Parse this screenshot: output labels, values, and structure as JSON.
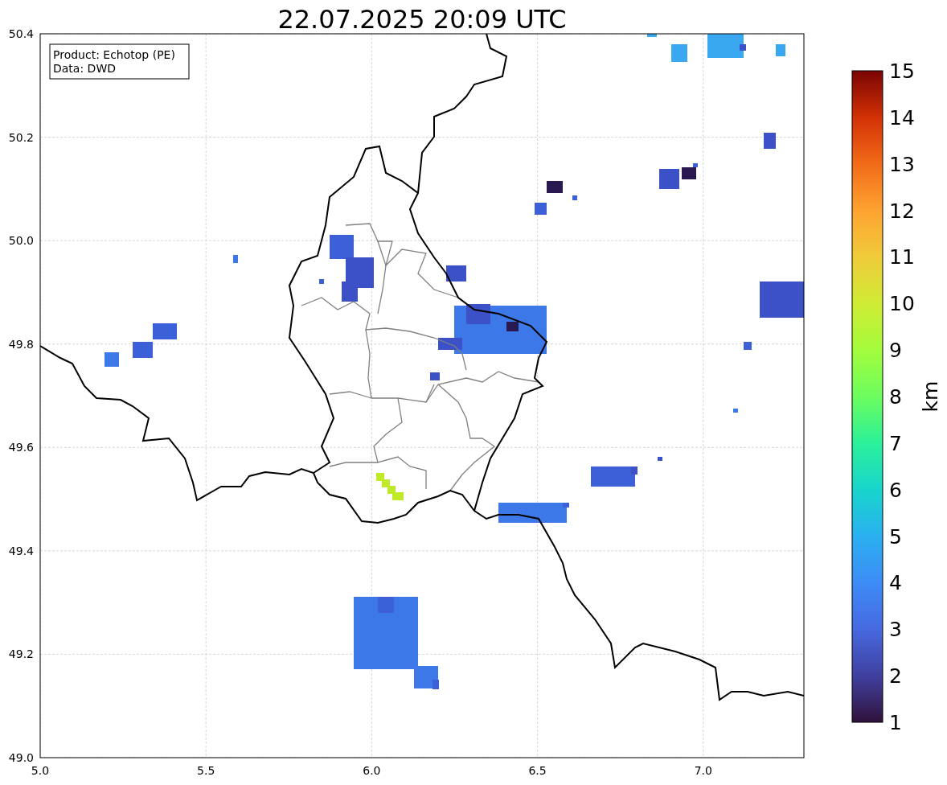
{
  "title": "22.07.2025 20:09 UTC",
  "info_box": [
    "Product: Echotop (PE)",
    "Data: DWD"
  ],
  "x_ticks": [
    "5.0",
    "5.5",
    "6.0",
    "6.5",
    "7.0"
  ],
  "y_ticks": [
    "50.4",
    "50.2",
    "50.0",
    "49.8",
    "49.6",
    "49.4",
    "49.2",
    "49.0"
  ],
  "colorbar": {
    "label": "km",
    "ticks": [
      "15",
      "14",
      "13",
      "12",
      "11",
      "10",
      "9",
      "8",
      "7",
      "6",
      "5",
      "4",
      "3",
      "2",
      "1"
    ]
  }
}
